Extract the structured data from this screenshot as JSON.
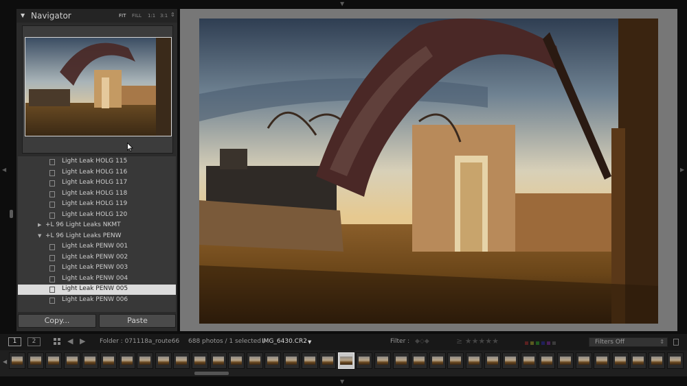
{
  "navigator": {
    "title": "Navigator",
    "zoom_options": [
      "FIT",
      "FILL",
      "1:1",
      "3:1"
    ]
  },
  "presets": {
    "rows": [
      {
        "type": "preset",
        "label": "Light Leak HOLG 115",
        "selected": false
      },
      {
        "type": "preset",
        "label": "Light Leak HOLG 116",
        "selected": false
      },
      {
        "type": "preset",
        "label": "Light Leak HOLG 117",
        "selected": false
      },
      {
        "type": "preset",
        "label": "Light Leak HOLG 118",
        "selected": false
      },
      {
        "type": "preset",
        "label": "Light Leak HOLG 119",
        "selected": false
      },
      {
        "type": "preset",
        "label": "Light Leak HOLG 120",
        "selected": false
      },
      {
        "type": "folder",
        "label": "+L 96 Light Leaks NKMT",
        "expanded": false
      },
      {
        "type": "folder",
        "label": "+L 96 Light Leaks PENW",
        "expanded": true
      },
      {
        "type": "preset",
        "label": "Light Leak PENW 001",
        "selected": false
      },
      {
        "type": "preset",
        "label": "Light Leak PENW 002",
        "selected": false
      },
      {
        "type": "preset",
        "label": "Light Leak PENW 003",
        "selected": false
      },
      {
        "type": "preset",
        "label": "Light Leak PENW 004",
        "selected": false
      },
      {
        "type": "preset",
        "label": "Light Leak PENW 005",
        "selected": true
      },
      {
        "type": "preset",
        "label": "Light Leak PENW 006",
        "selected": false
      }
    ]
  },
  "panel_buttons": {
    "copy": "Copy...",
    "paste": "Paste"
  },
  "filmstrip_toolbar": {
    "screen1": "1",
    "screen2": "2",
    "folder_label": "Folder : 071118a_route66",
    "photo_count": "688 photos / 1 selected /",
    "filename": "IMG_6430.CR2",
    "filter_label": "Filter :",
    "filters_off": "Filters Off"
  },
  "filmstrip": {
    "thumbnail_count": 37,
    "selected_index": 18
  },
  "colors": {
    "selected_row": "#dcdcdc",
    "background": "#0d0d0d",
    "panel": "#2b2b2b",
    "main_bg": "#777777"
  },
  "icons": [
    "navigator-collapse-icon",
    "preset-icon",
    "folder-expand-icon",
    "grid-view-icon",
    "back-arrow-icon",
    "forward-arrow-icon",
    "star-icon",
    "color-label-icon",
    "mouse-cursor-icon"
  ]
}
